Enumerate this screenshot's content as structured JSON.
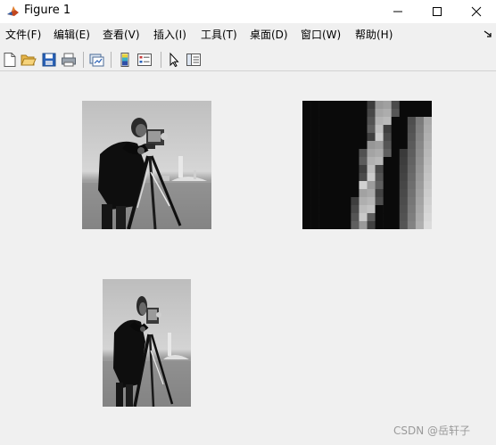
{
  "window": {
    "title": "Figure 1",
    "controls": {
      "minimize": "minimize",
      "maximize": "maximize",
      "close": "close"
    }
  },
  "menu": {
    "items": [
      {
        "label": "文件(F)"
      },
      {
        "label": "编辑(E)"
      },
      {
        "label": "查看(V)"
      },
      {
        "label": "插入(I)"
      },
      {
        "label": "工具(T)"
      },
      {
        "label": "桌面(D)"
      },
      {
        "label": "窗口(W)"
      },
      {
        "label": "帮助(H)"
      }
    ]
  },
  "toolbar": {
    "buttons": [
      {
        "icon": "new-figure-icon"
      },
      {
        "icon": "open-file-icon"
      },
      {
        "icon": "save-icon"
      },
      {
        "icon": "print-icon"
      },
      {
        "icon": "link-plot-icon"
      },
      {
        "icon": "insert-colorbar-icon"
      },
      {
        "icon": "insert-legend-icon"
      },
      {
        "icon": "edit-plot-cursor-icon"
      },
      {
        "icon": "property-inspector-icon"
      }
    ]
  },
  "figure": {
    "images": [
      {
        "name": "cameraman-original",
        "description_icon": "cameraman-photo"
      },
      {
        "name": "cameraman-zoomed-crop",
        "description_icon": "zoomed-pixels"
      },
      {
        "name": "cameraman-resized",
        "description_icon": "cameraman-photo"
      }
    ]
  },
  "watermark": "CSDN @岳轩子",
  "colors": {
    "window_bg": "#f0f0f0",
    "titlebar_bg": "#ffffff",
    "accent_blue": "#2a62b8"
  }
}
